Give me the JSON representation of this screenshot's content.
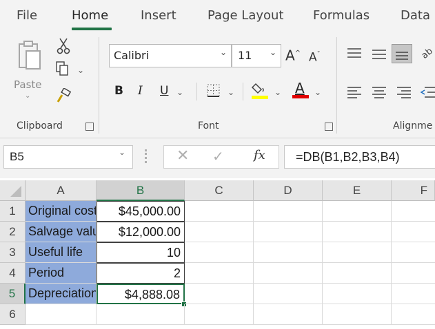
{
  "tabs": [
    {
      "label": "File",
      "active": false
    },
    {
      "label": "Home",
      "active": true
    },
    {
      "label": "Insert",
      "active": false
    },
    {
      "label": "Page Layout",
      "active": false
    },
    {
      "label": "Formulas",
      "active": false
    },
    {
      "label": "Data",
      "active": false
    }
  ],
  "clipboard": {
    "paste_label": "Paste",
    "group_label": "Clipboard"
  },
  "font": {
    "name": "Calibri",
    "size": "11",
    "group_label": "Font",
    "bold": "B",
    "italic": "I",
    "underline": "U",
    "font_color_glyph": "A",
    "highlight_color": "#ffff00",
    "font_color": "#e00000"
  },
  "alignment": {
    "group_label": "Alignme"
  },
  "formula_bar": {
    "name_box": "B5",
    "fx": "fx",
    "formula": "=DB(B1,B2,B3,B4)"
  },
  "columns": [
    "A",
    "B",
    "C",
    "D",
    "E",
    "F"
  ],
  "rows": [
    {
      "num": "1",
      "a": "Original cost",
      "b": "$45,000.00"
    },
    {
      "num": "2",
      "a": "Salvage value",
      "b": "$12,000.00"
    },
    {
      "num": "3",
      "a": "Useful life",
      "b": "10"
    },
    {
      "num": "4",
      "a": "Period",
      "b": "2"
    },
    {
      "num": "5",
      "a": "Depreciation",
      "b": "$4,888.08"
    },
    {
      "num": "6",
      "a": "",
      "b": ""
    }
  ],
  "accent_color": "#217346",
  "label_fill_color": "#8eaadb"
}
